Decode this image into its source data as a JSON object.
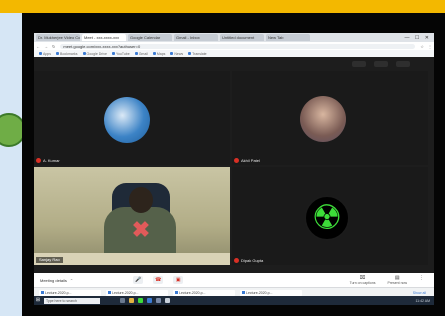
{
  "browser": {
    "tabs": [
      {
        "label": "Dr. Mukherjee Video Co..."
      },
      {
        "label": "Meet - xxx-xxxx-xxx"
      },
      {
        "label": "Google Calendar"
      },
      {
        "label": "Gmail - Inbox"
      },
      {
        "label": "Untitled document"
      },
      {
        "label": "New Tab"
      }
    ],
    "window_buttons": "— ☐ ✕",
    "url": "meet.google.com/xxx-xxxx-xxx?authuser=0",
    "bookmarks": [
      "Apps",
      "Bookmarks",
      "Google Drive",
      "YouTube",
      "Gmail",
      "Maps",
      "News",
      "Translate"
    ]
  },
  "meeting": {
    "top_controls": [
      "",
      "",
      ""
    ],
    "participants": [
      {
        "name": "A. Kumar",
        "avatar_icon": "globe-avatar-icon"
      },
      {
        "name": "Akhil Patel",
        "avatar_icon": "person-photo-avatar-icon"
      },
      {
        "name": "Sanjay Rao",
        "avatar_icon": "video-feed"
      },
      {
        "name": "Dipak Gupta",
        "avatar_icon": "radiation-symbol-icon"
      }
    ],
    "mute_symbol": "✖",
    "radiation_glyph": "☢"
  },
  "toolbar": {
    "meeting_details": "Meeting details",
    "chevron": "⌃",
    "center_controls": [
      {
        "icon": "microphone-icon",
        "symbol": "🎤"
      },
      {
        "icon": "hang-up-icon",
        "symbol": "☎"
      },
      {
        "icon": "camera-icon",
        "symbol": "▣"
      }
    ],
    "right_controls": [
      {
        "icon": "captions-icon",
        "symbol": "⌧",
        "label": "Turn on captions"
      },
      {
        "icon": "present-icon",
        "symbol": "▤",
        "label": "Present now"
      },
      {
        "icon": "more-options-icon",
        "symbol": "⋮",
        "label": ""
      }
    ]
  },
  "downloads": {
    "items": [
      "Lecture-2020.p...",
      "Lecture-2020.p...",
      "Lecture-2020.p...",
      "Lecture-2020.p..."
    ],
    "show_all": "Show all"
  },
  "taskbar": {
    "start": "⊞",
    "search_placeholder": "Type here to search",
    "icons": [
      {
        "name": "task-view-icon",
        "color": "#6b7a8f"
      },
      {
        "name": "file-explorer-icon",
        "color": "#e3b341"
      },
      {
        "name": "chrome-icon",
        "color": "#3ddc39"
      },
      {
        "name": "edge-icon",
        "color": "#3b7bd4"
      },
      {
        "name": "store-icon",
        "color": "#7a8aa8"
      },
      {
        "name": "mail-icon",
        "color": "#c8d0da"
      }
    ],
    "clock": "11:42 AM"
  },
  "colors": {
    "accent_border": "#f3b800",
    "meeting_bg": "#1d1d1d",
    "mute_red": "#d93025",
    "radiation_green": "#3ddc39"
  }
}
